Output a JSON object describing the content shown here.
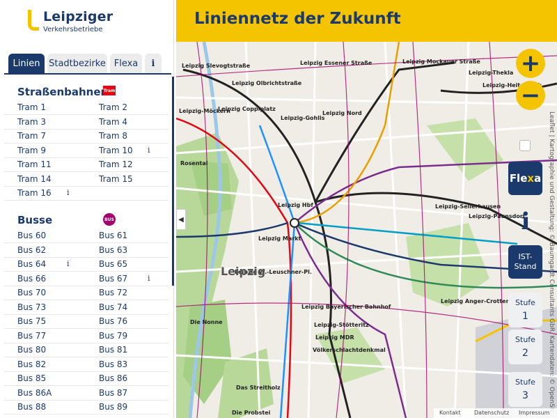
{
  "brand": {
    "name": "Leipziger",
    "subtitle": "Verkehrsbetriebe"
  },
  "header": {
    "title": "Liniennetz der Zukunft"
  },
  "tabs": [
    {
      "label": "Linien",
      "active": true
    },
    {
      "label": "Stadtbezirke",
      "active": false
    },
    {
      "label": "Flexa",
      "active": false
    },
    {
      "label": "i",
      "active": false
    }
  ],
  "tram": {
    "title": "Straßenbahnen",
    "badge": "Tram",
    "lines": [
      "Tram 1",
      "Tram 2",
      "Tram 3",
      "Tram 4",
      "Tram 7",
      "Tram 8",
      "Tram 9",
      "Tram 10",
      "Tram 11",
      "Tram 12",
      "Tram 14",
      "Tram 15",
      "Tram 16"
    ]
  },
  "bus": {
    "title": "Busse",
    "badge": "BUS",
    "lines": [
      "Bus 60",
      "Bus 61",
      "Bus 62",
      "Bus 63",
      "Bus 64",
      "Bus 65",
      "Bus 66",
      "Bus 67",
      "Bus 70",
      "Bus 72",
      "Bus 73",
      "Bus 74",
      "Bus 75",
      "Bus 76",
      "Bus 77",
      "Bus 79",
      "Bus 80",
      "Bus 81",
      "Bus 82",
      "Bus 83",
      "Bus 85",
      "Bus 86",
      "Bus 86A",
      "Bus 87",
      "Bus 88",
      "Bus 89"
    ]
  },
  "info_marker": "i",
  "map": {
    "zoom_in": "+",
    "zoom_out": "−",
    "flexa": {
      "left": "Fle",
      "x": "x",
      "right": "a"
    },
    "info": "i",
    "ist": "IST-\nStand",
    "stufen": [
      {
        "label": "Stufe",
        "num": "1"
      },
      {
        "label": "Stufe",
        "num": "2"
      },
      {
        "label": "Stufe",
        "num": "3"
      }
    ],
    "attribution": "Leaflet | Kartographie und Gestaltung: © Baumgardt Consultants GbR, Kartendaten: © OpenStr",
    "footer": [
      "Kontakt",
      "Datenschutz",
      "Impressum"
    ],
    "city": "Leipzig",
    "labels": [
      "Leipzig Slevogtstraße",
      "Leipzig Essener Straße",
      "Leipzig Mockauer Straße",
      "Leipzig-Thekla",
      "Leipzig Olbrichtstraße",
      "Leipzig-Heiterblick",
      "Leipzig-Möckern",
      "Leipzig Coppiplatz",
      "Leipzig Nord",
      "Leipzig-Gohlis",
      "Leipzig Hbf",
      "Leipzig-Sellerhausen",
      "Leipzig-Paunsdorf",
      "Leipzig Markt",
      "Leipzig W.-Leuschner-Pl.",
      "Leipzig Bayerischer Bahnhof",
      "Leipzig Anger-Crottendorf",
      "Leipzig-Stötteritz",
      "Leipzig MDR",
      "Völkerschlachtdenkmal",
      "Rosental",
      "Die Nonne",
      "Das Streitholz",
      "Die Probstei"
    ]
  }
}
